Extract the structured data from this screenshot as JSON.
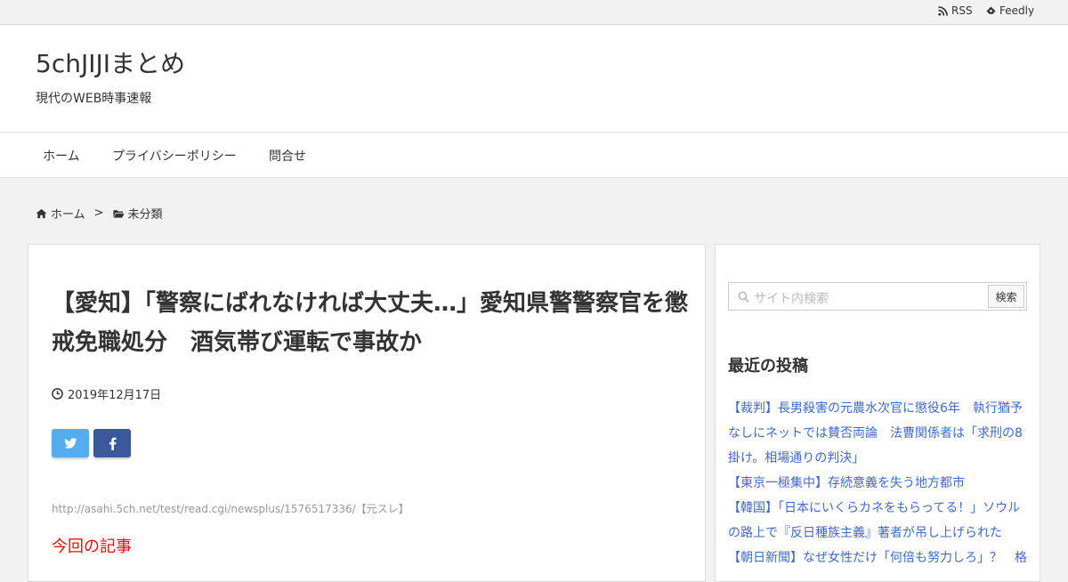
{
  "topbar": {
    "rss_label": "RSS",
    "feedly_label": "Feedly"
  },
  "header": {
    "site_title": "5chJIJIまとめ",
    "site_description": "現代のWEB時事速報"
  },
  "nav": {
    "items": [
      {
        "label": "ホーム"
      },
      {
        "label": "プライバシーポリシー"
      },
      {
        "label": "問合せ"
      }
    ]
  },
  "breadcrumb": {
    "home": "ホーム",
    "separator": ">",
    "category": "未分類"
  },
  "post": {
    "title": "【愛知】「警察にばれなければ大丈夫…」愛知県警警察官を懲戒免職処分　酒気帯び運転で事故か",
    "date": "2019年12月17日",
    "source_link": "http://asahi.5ch.net/test/read.cgi/newsplus/1576517336/【元スレ】",
    "article_heading": "今回の記事"
  },
  "share": {
    "twitter_color": "#55acee",
    "facebook_color": "#3b5998",
    "twitter_icon": "twitter-icon",
    "facebook_icon": "facebook-icon"
  },
  "sidebar": {
    "search_placeholder": "サイト内検索",
    "search_button": "検索",
    "recent_title": "最近の投稿",
    "recent_posts": [
      {
        "title": "【裁判】長男殺害の元農水次官に懲役6年　執行猶予なしにネットでは賛否両論　法曹関係者は「求刑の8掛け。相場通りの判決」"
      },
      {
        "title": "【東京一極集中】存続意義を失う地方都市"
      },
      {
        "title": "【韓国】「日本にいくらカネをもらってる！」ソウルの路上で『反日種族主義』著者が吊し上げられた"
      },
      {
        "title": "【朝日新聞】なぜ女性だけ「何倍も努力しろ」？　格"
      }
    ]
  },
  "colors": {
    "link": "#4169c8",
    "accent_red": "#e01010"
  }
}
